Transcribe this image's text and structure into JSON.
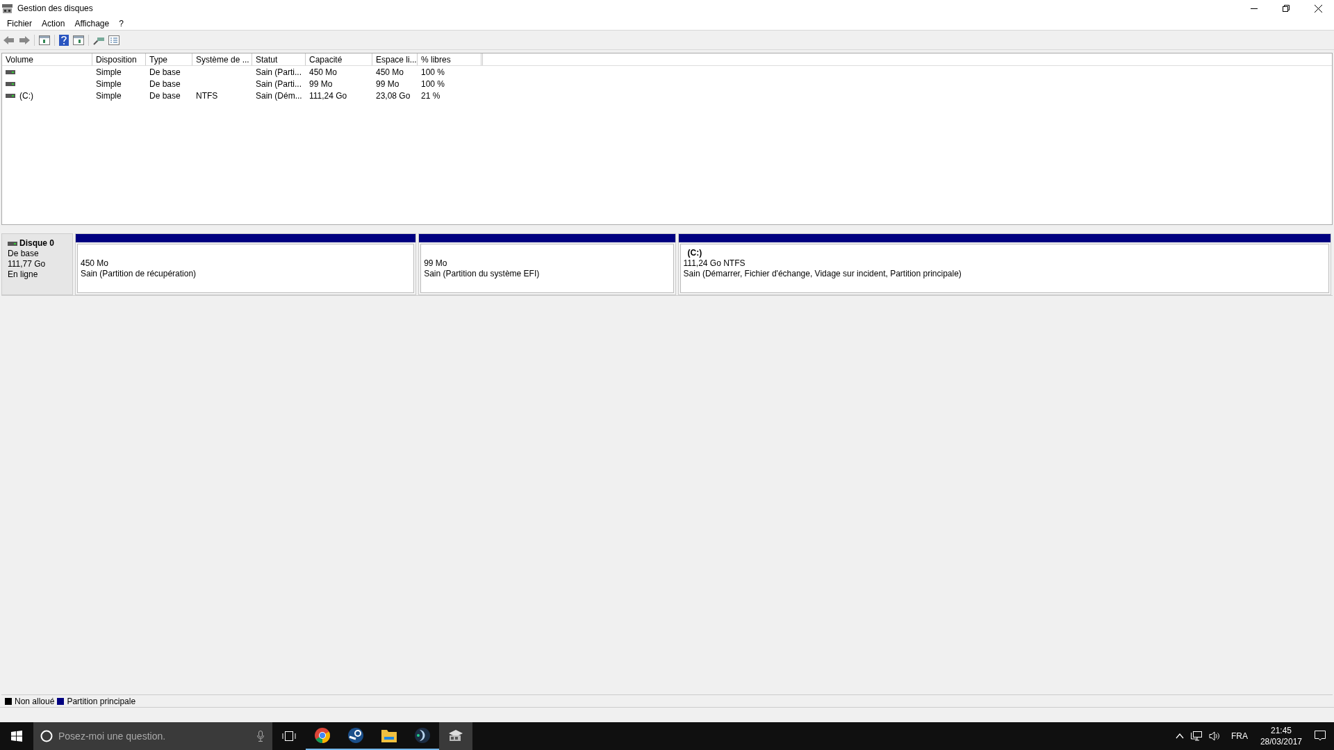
{
  "window": {
    "title": "Gestion des disques"
  },
  "menu": [
    "Fichier",
    "Action",
    "Affichage",
    "?"
  ],
  "table": {
    "columns": [
      "Volume",
      "Disposition",
      "Type",
      "Système de ...",
      "Statut",
      "Capacité",
      "Espace li...",
      "% libres"
    ],
    "rows": [
      {
        "cells": [
          null,
          "Simple",
          "De base",
          null,
          "Sain (Parti...",
          "450 Mo",
          "450 Mo",
          "100 %"
        ]
      },
      {
        "cells": [
          null,
          "Simple",
          "De base",
          null,
          "Sain (Parti...",
          "99 Mo",
          "99 Mo",
          "100 %"
        ]
      },
      {
        "cells": [
          "(C:)",
          "Simple",
          "De base",
          "NTFS",
          "Sain (Dém...",
          "111,24 Go",
          "23,08 Go",
          "21 %"
        ]
      }
    ]
  },
  "disk": {
    "name": "Disque 0",
    "type": "De base",
    "size": "111,77 Go",
    "status": "En ligne",
    "partitions": [
      {
        "size": "450 Mo",
        "status": "Sain (Partition de récupération)",
        "color": "#000080"
      },
      {
        "size": "99 Mo",
        "status": "Sain (Partition du système EFI)",
        "color": "#000080"
      },
      {
        "label": "(C:)",
        "size": "111,24 Go NTFS",
        "status": "Sain (Démarrer, Fichier d'échange, Vidage sur incident, Partition principale)",
        "color": "#000080"
      }
    ]
  },
  "legend": [
    {
      "label": "Non alloué",
      "color": "#000000"
    },
    {
      "label": "Partition principale",
      "color": "#000080"
    }
  ],
  "taskbar": {
    "search_placeholder": "Posez-moi une question.",
    "apps": [
      {
        "kind": "chrome",
        "running": true,
        "selected": false
      },
      {
        "kind": "steam",
        "running": true,
        "selected": false
      },
      {
        "kind": "folder",
        "running": true,
        "selected": false
      },
      {
        "kind": "dolphin",
        "running": true,
        "selected": false
      },
      {
        "kind": "disk",
        "running": false,
        "selected": true
      }
    ],
    "language": "FRA",
    "time": "21:45",
    "date": "28/03/2017"
  }
}
